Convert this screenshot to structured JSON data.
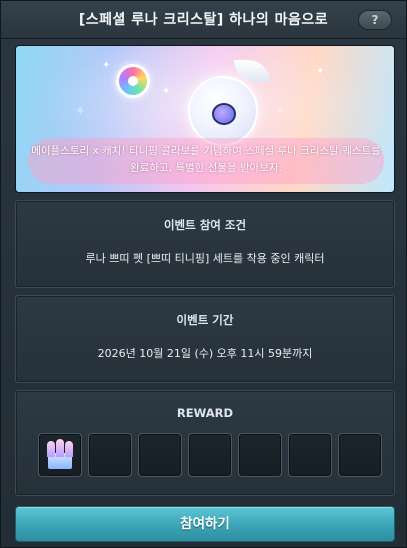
{
  "window": {
    "title": "[스페셜 루나 크리스탈] 하나의 마음으로",
    "help_label": "?"
  },
  "banner": {
    "caption": "메이플스토리 x 캐치! 티니핑 콜라보를 기념하여 스페셜 루나 크리스탈 퀘스트를 완료하고, 특별한 선물을 받아보자."
  },
  "condition": {
    "title": "이벤트 참여 조건",
    "text": "루나 쁘띠 펫 [쁘띠 티니핑] 세트를 착용 중인 캐릭터"
  },
  "period": {
    "title": "이벤트 기간",
    "text": "2026년 10월 21일 (수) 오후 11시 59분까지"
  },
  "reward": {
    "title": "REWARD",
    "slots": [
      {
        "filled": true,
        "icon": "castle-item-icon"
      },
      {
        "filled": false
      },
      {
        "filled": false
      },
      {
        "filled": false
      },
      {
        "filled": false
      },
      {
        "filled": false
      },
      {
        "filled": false
      }
    ]
  },
  "join_button": {
    "label": "참여하기"
  },
  "colors": {
    "accent": "#3aa3b6",
    "panel": "#2d3943",
    "background": "#222d36"
  }
}
